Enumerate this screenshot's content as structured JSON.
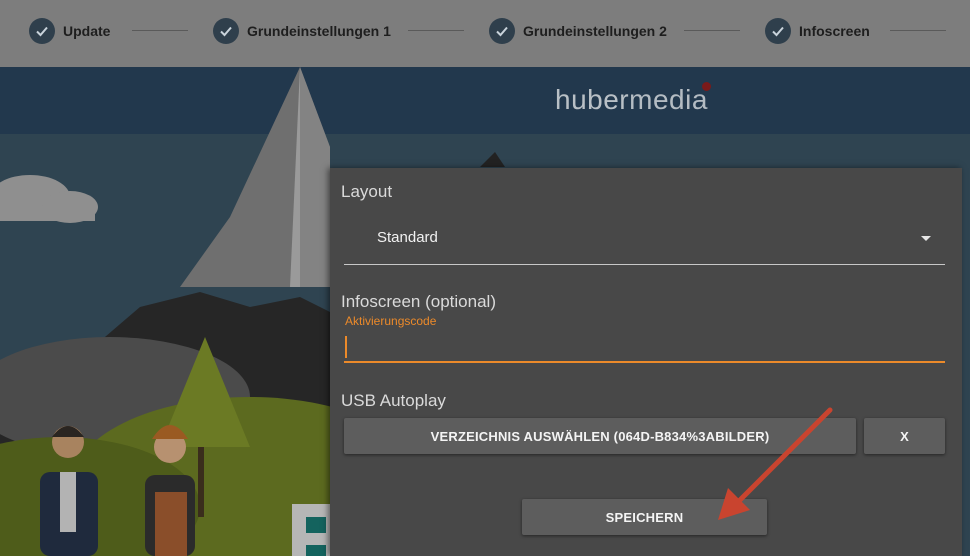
{
  "stepper": {
    "steps": [
      {
        "label": "Update"
      },
      {
        "label": "Grundeinstellungen 1"
      },
      {
        "label": "Grundeinstellungen 2"
      },
      {
        "label": "Infoscreen"
      }
    ]
  },
  "brand": {
    "part1": "huber",
    "part2": "media"
  },
  "dialog": {
    "layout_title": "Layout",
    "layout_value": "Standard",
    "infoscreen_title": "Infoscreen (optional)",
    "activation_label": "Aktivierungscode",
    "activation_value": "",
    "usb_title": "USB Autoplay",
    "choose_dir_label": "VERZEICHNIS AUSWÄHLEN (064D-B834%3ABILDER)",
    "clear_label": "X",
    "save_label": "SPEICHERN"
  },
  "colors": {
    "accent": "#ec8a2a",
    "stepper_bg": "#7d7d7d",
    "dialog_bg": "#484848",
    "annotation_arrow": "#c9442f"
  },
  "icons": [
    "check-icon",
    "dropdown-caret-icon",
    "annotation-arrow-icon"
  ]
}
